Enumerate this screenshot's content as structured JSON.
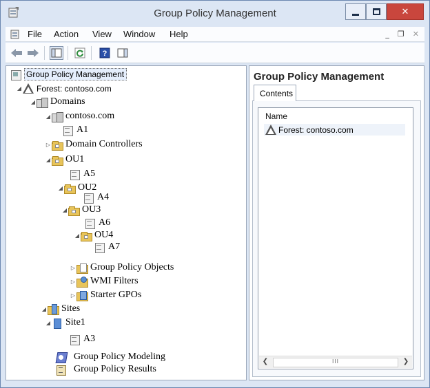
{
  "window": {
    "title": "Group Policy Management"
  },
  "menu": {
    "items": [
      "File",
      "Action",
      "View",
      "Window",
      "Help"
    ]
  },
  "tree": {
    "root": "Group Policy Management",
    "forest": "Forest: contoso.com",
    "domains": "Domains",
    "domain": "contoso.com",
    "a1": "A1",
    "domain_controllers": "Domain Controllers",
    "ou1": "OU1",
    "a5": "A5",
    "ou2": "OU2",
    "a4": "A4",
    "ou3": "OU3",
    "a6": "A6",
    "ou4": "OU4",
    "a7": "A7",
    "gpo_objects": "Group Policy Objects",
    "wmi_filters": "WMI Filters",
    "starter_gpos": "Starter GPOs",
    "sites": "Sites",
    "site1": "Site1",
    "a3": "A3",
    "modeling": "Group Policy Modeling",
    "results": "Group Policy Results"
  },
  "details": {
    "title": "Group Policy Management",
    "tab": "Contents",
    "column": "Name",
    "rows": [
      "Forest: contoso.com"
    ]
  },
  "scrollbar": {
    "thumb_grip": "III"
  }
}
